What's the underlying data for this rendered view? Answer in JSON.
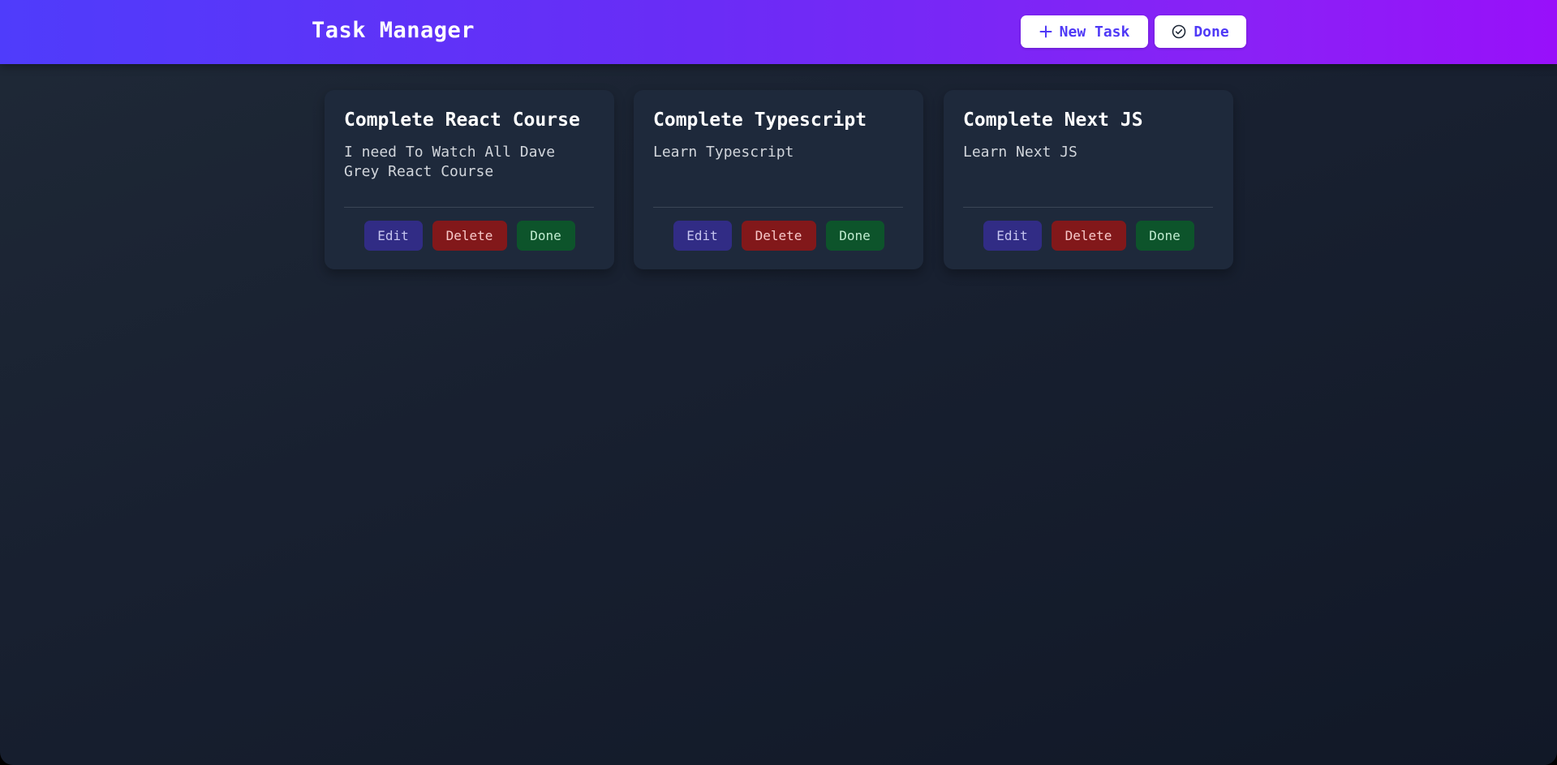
{
  "header": {
    "title": "Task Manager",
    "new_task_label": "New Task",
    "done_label": "Done",
    "new_task_icon": "plus-icon",
    "done_icon": "check-circle-icon"
  },
  "colors": {
    "header_gradient_start": "#4f3cfb",
    "header_gradient_end": "#9810fa",
    "card_bg": "#1e293b",
    "edit_bg": "#312c85",
    "delete_bg": "#82181a",
    "done_bg": "#0d542b"
  },
  "tasks": [
    {
      "title": "Complete React Course",
      "description": "I need To Watch All Dave Grey React Course",
      "edit_label": "Edit",
      "delete_label": "Delete",
      "done_label": "Done"
    },
    {
      "title": "Complete Typescript",
      "description": "Learn Typescript",
      "edit_label": "Edit",
      "delete_label": "Delete",
      "done_label": "Done"
    },
    {
      "title": "Complete Next JS",
      "description": "Learn Next JS",
      "edit_label": "Edit",
      "delete_label": "Delete",
      "done_label": "Done"
    }
  ]
}
